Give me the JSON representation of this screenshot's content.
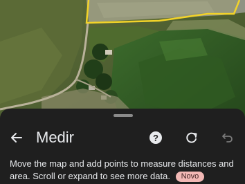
{
  "map": {
    "accent_color": "#f2d32a"
  },
  "panel": {
    "title": "Medir",
    "description": "Move the map and add points to measure distances and area. Scroll or expand to see more data.",
    "badge": "Novo",
    "icons": {
      "back": "arrow-back-icon",
      "help": "help-circle-icon",
      "reset": "refresh-icon",
      "undo": "undo-icon"
    },
    "badge_color": "#f2b8b5"
  }
}
